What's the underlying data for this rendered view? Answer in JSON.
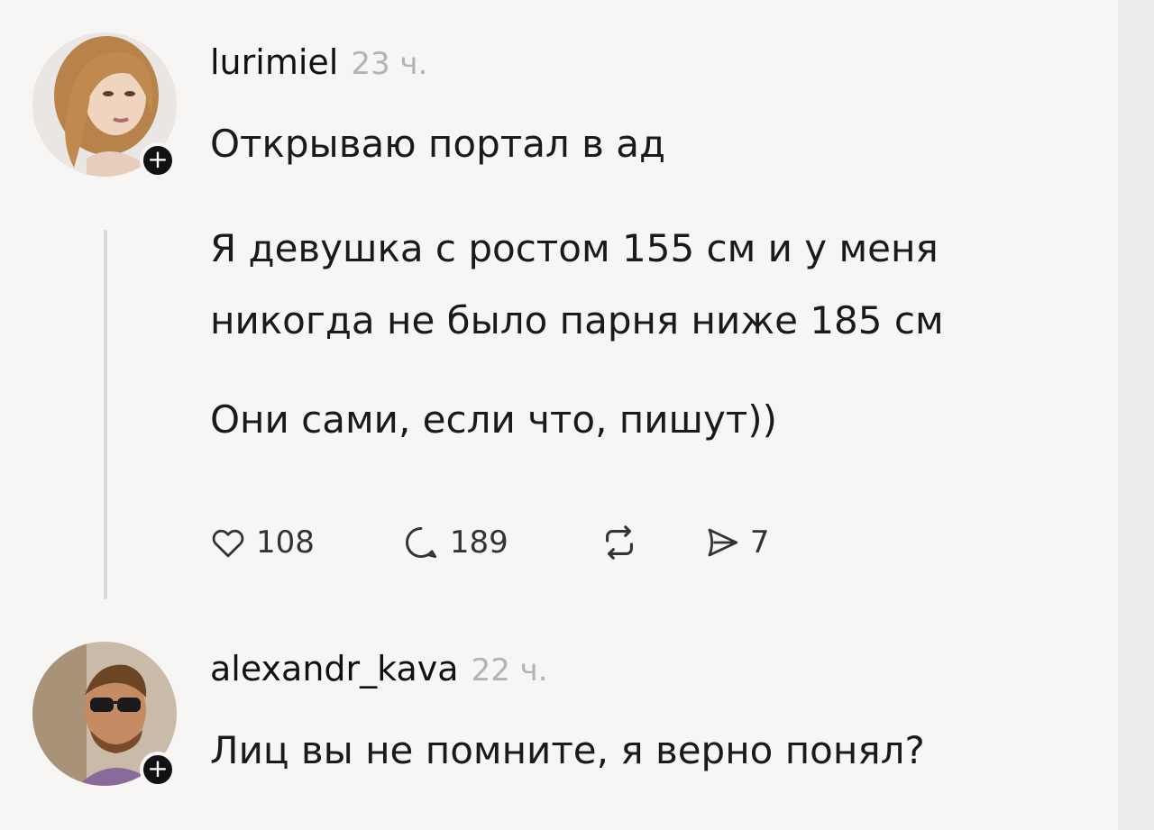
{
  "post": {
    "username": "lurimiel",
    "time": "23 ч.",
    "paragraphs": [
      "Открываю портал в ад",
      "Я девушка с ростом 155 см и у меня",
      "никогда не было парня ниже 185 см",
      "Они сами, если что, пишут))"
    ],
    "actions": {
      "likes": "108",
      "comments": "189",
      "shares": "7"
    },
    "follow_badge": "+"
  },
  "reply": {
    "username": "alexandr_kava",
    "time": "22 ч.",
    "text": "Лиц вы не помните, я верно понял?",
    "follow_badge": "+"
  },
  "icons": [
    "heart-icon",
    "comment-icon",
    "repost-icon",
    "send-icon",
    "plus-icon"
  ],
  "colors": {
    "background": "#f7f6f5",
    "text": "#1a1a1a",
    "muted": "#b3b3b3",
    "badge": "#111111"
  }
}
